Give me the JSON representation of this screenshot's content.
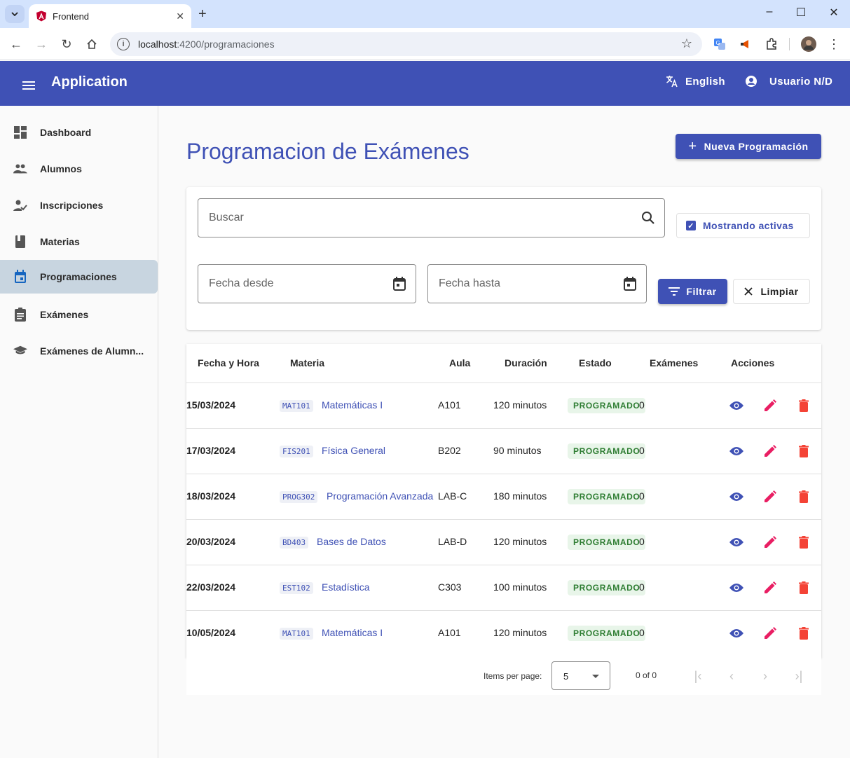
{
  "browser": {
    "tab_title": "Frontend",
    "url_host": "localhost",
    "url_path": ":4200/programaciones"
  },
  "header": {
    "app_title": "Application",
    "language_label": "English",
    "user_label": "Usuario N/D"
  },
  "sidebar": {
    "items": [
      {
        "label": "Dashboard",
        "icon": "dashboard-icon"
      },
      {
        "label": "Alumnos",
        "icon": "people-icon"
      },
      {
        "label": "Inscripciones",
        "icon": "person-check-icon"
      },
      {
        "label": "Materias",
        "icon": "book-icon"
      },
      {
        "label": "Programaciones",
        "icon": "calendar-icon",
        "active": true
      },
      {
        "label": "Exámenes",
        "icon": "clipboard-icon"
      },
      {
        "label": "Exámenes de Alumn...",
        "icon": "school-icon"
      }
    ]
  },
  "main": {
    "title": "Programacion de Exámenes",
    "new_button_label": "Nueva Programación",
    "search_placeholder": "Buscar",
    "active_toggle_label": "Mostrando activas",
    "date_from_placeholder": "Fecha desde",
    "date_to_placeholder": "Fecha hasta",
    "filter_button_label": "Filtrar",
    "clear_button_label": "Limpiar"
  },
  "table": {
    "columns": [
      "Fecha y Hora",
      "Materia",
      "Aula",
      "Duración",
      "Estado",
      "Exámenes",
      "Acciones"
    ],
    "rows": [
      {
        "fecha": "15/03/2024",
        "codigo": "MAT101",
        "materia": "Matemáticas I",
        "aula": "A101",
        "duracion": "120 minutos",
        "estado": "PROGRAMADO",
        "examenes": "0"
      },
      {
        "fecha": "17/03/2024",
        "codigo": "FIS201",
        "materia": "Física General",
        "aula": "B202",
        "duracion": "90 minutos",
        "estado": "PROGRAMADO",
        "examenes": "0"
      },
      {
        "fecha": "18/03/2024",
        "codigo": "PROG302",
        "materia": "Programación Avanzada",
        "aula": "LAB-C",
        "duracion": "180 minutos",
        "estado": "PROGRAMADO",
        "examenes": "0"
      },
      {
        "fecha": "20/03/2024",
        "codigo": "BD403",
        "materia": "Bases de Datos",
        "aula": "LAB-D",
        "duracion": "120 minutos",
        "estado": "PROGRAMADO",
        "examenes": "0"
      },
      {
        "fecha": "22/03/2024",
        "codigo": "EST102",
        "materia": "Estadística",
        "aula": "C303",
        "duracion": "100 minutos",
        "estado": "PROGRAMADO",
        "examenes": "0"
      },
      {
        "fecha": "10/05/2024",
        "codigo": "MAT101",
        "materia": "Matemáticas I",
        "aula": "A101",
        "duracion": "120 minutos",
        "estado": "PROGRAMADO",
        "examenes": "0"
      }
    ]
  },
  "paginator": {
    "items_per_page_label": "Items per page:",
    "page_size": "5",
    "range_label": "0 of 0"
  },
  "colors": {
    "primary": "#3f51b5",
    "view_icon": "#3f51b5",
    "edit_icon": "#e91e63",
    "delete_icon": "#f44336",
    "status_bg": "#e8f5e9",
    "status_text": "#2e7d32"
  }
}
